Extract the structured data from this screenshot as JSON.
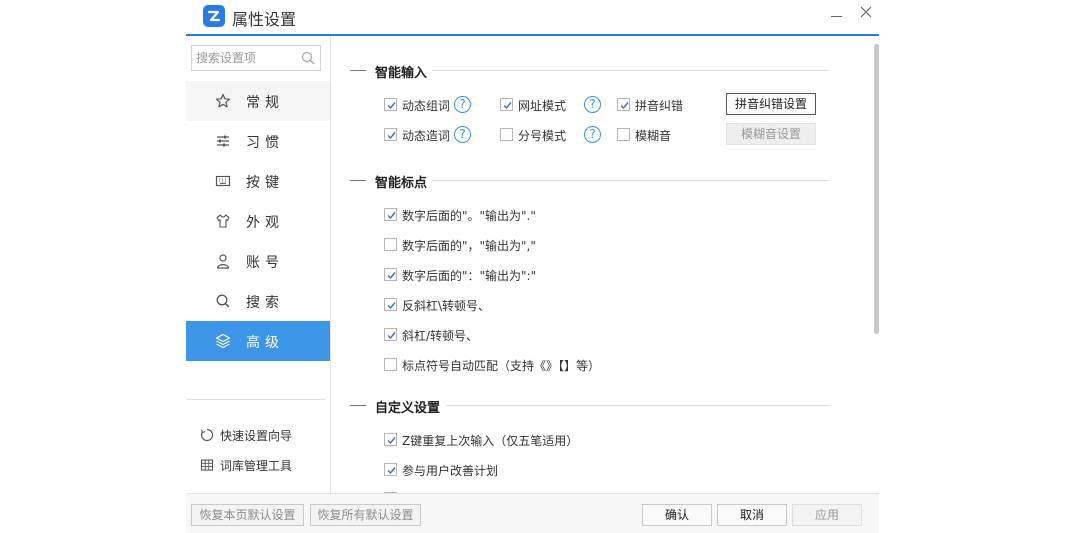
{
  "window": {
    "title": "属性设置"
  },
  "search": {
    "placeholder": "搜索设置项"
  },
  "sidebar": {
    "items": [
      {
        "label": "常规",
        "icon": "star-icon"
      },
      {
        "label": "习惯",
        "icon": "sliders-icon"
      },
      {
        "label": "按键",
        "icon": "keyboard-icon"
      },
      {
        "label": "外观",
        "icon": "shirt-icon"
      },
      {
        "label": "账号",
        "icon": "user-icon"
      },
      {
        "label": "搜索",
        "icon": "search-icon"
      },
      {
        "label": "高级",
        "icon": "layers-icon",
        "active": true
      }
    ],
    "tools": [
      {
        "label": "快速设置向导",
        "icon": "refresh-icon"
      },
      {
        "label": "词库管理工具",
        "icon": "grid-icon"
      }
    ]
  },
  "sections": {
    "smart_input": {
      "title": "智能输入",
      "options": {
        "dynamic_word": {
          "label": "动态组词",
          "checked": true
        },
        "url_mode": {
          "label": "网址模式",
          "checked": true
        },
        "pinyin_correct": {
          "label": "拼音纠错",
          "checked": true
        },
        "dynamic_create": {
          "label": "动态造词",
          "checked": true
        },
        "semicolon_mode": {
          "label": "分号模式",
          "checked": false
        },
        "fuzzy": {
          "label": "模糊音",
          "checked": false
        }
      },
      "help_glyph": "?",
      "pinyin_correct_button": "拼音纠错设置",
      "fuzzy_button": "模糊音设置"
    },
    "smart_punct": {
      "title": "智能标点",
      "options": [
        {
          "label": "数字后面的\"。\"输出为\".\"",
          "checked": true
        },
        {
          "label": "数字后面的\"，\"输出为\",\"",
          "checked": false
        },
        {
          "label": "数字后面的\"：\"输出为\":\"",
          "checked": true
        },
        {
          "label": "反斜杠\\转顿号、",
          "checked": true
        },
        {
          "label": "斜杠/转顿号、",
          "checked": true
        },
        {
          "label": "标点符号自动匹配（支持《》【】等）",
          "checked": false
        }
      ]
    },
    "custom": {
      "title": "自定义设置",
      "options": [
        {
          "label": "Z键重复上次输入（仅五笔适用）",
          "checked": true
        },
        {
          "label": "参与用户改善计划",
          "checked": true
        }
      ]
    }
  },
  "footer": {
    "restore_page": "恢复本页默认设置",
    "restore_all": "恢复所有默认设置",
    "confirm": "确认",
    "cancel": "取消",
    "apply": "应用"
  },
  "colors": {
    "accent": "#3d95e8",
    "help": "#3d8ee0"
  }
}
